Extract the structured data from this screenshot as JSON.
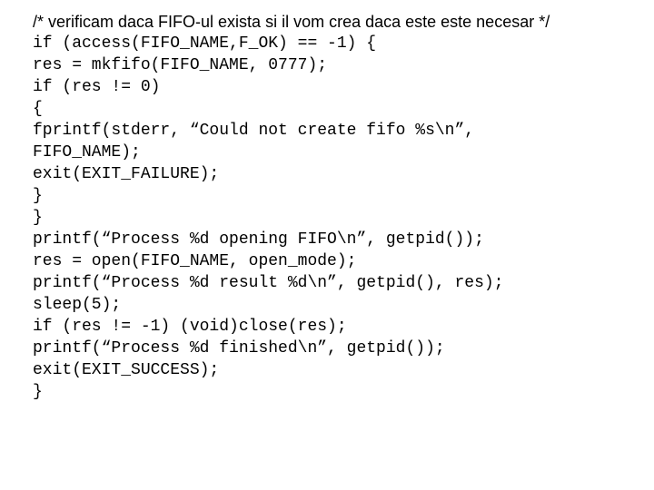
{
  "code": {
    "comment": "/* verificam daca FIFO-ul exista si il vom crea daca este este necesar */",
    "l01": "if (access(FIFO_NAME,F_OK) == -1) {",
    "l02": "res = mkfifo(FIFO_NAME, 0777);",
    "l03": "if (res != 0)",
    "l04": "{",
    "l05": "fprintf(stderr, “Could not create fifo %s\\n”,",
    "l06": "FIFO_NAME);",
    "l07": "exit(EXIT_FAILURE);",
    "l08": "}",
    "l09": "}",
    "l10": "printf(“Process %d opening FIFO\\n”, getpid());",
    "l11": "res = open(FIFO_NAME, open_mode);",
    "l12": "printf(“Process %d result %d\\n”, getpid(), res);",
    "l13": "sleep(5);",
    "l14": "if (res != -1) (void)close(res);",
    "l15": "printf(“Process %d finished\\n”, getpid());",
    "l16": "exit(EXIT_SUCCESS);",
    "l17": "}"
  }
}
